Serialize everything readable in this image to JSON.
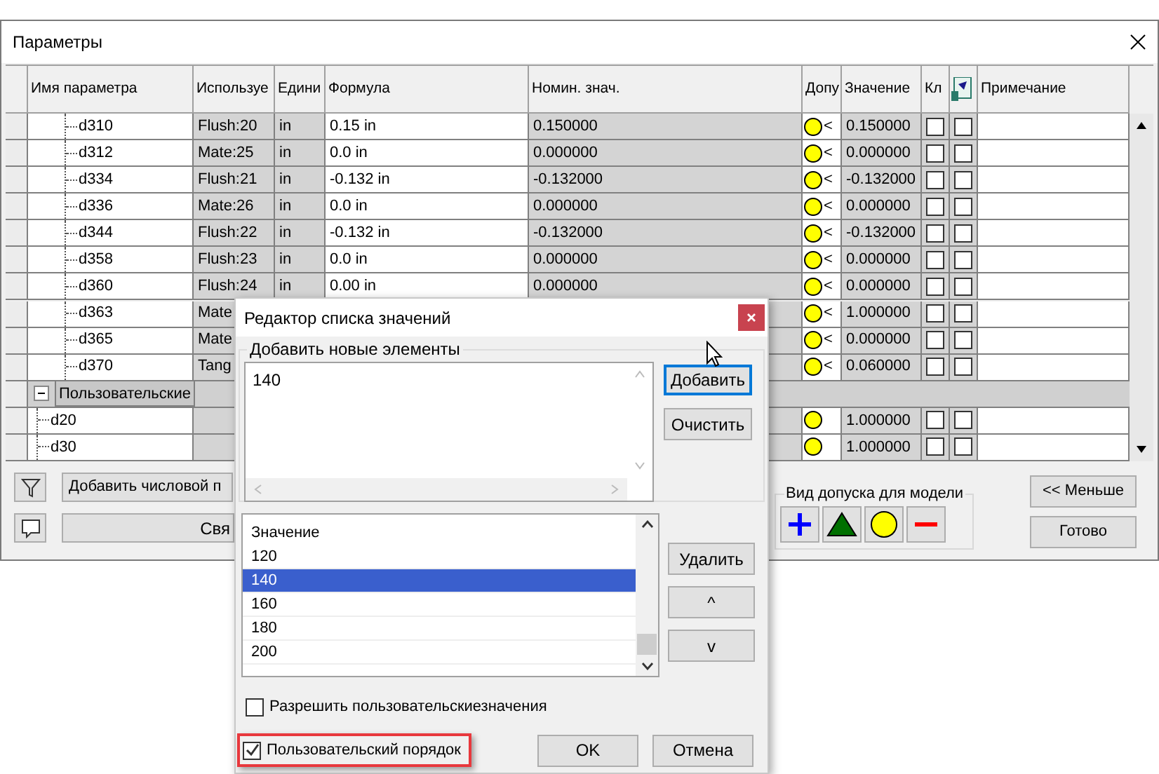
{
  "window": {
    "title": "Параметры"
  },
  "table": {
    "columns": [
      "Имя параметра",
      "Используе",
      "Едини",
      "Формула",
      "Номин. знач.",
      "Допу",
      "Значение",
      "Кл",
      "Примечание"
    ],
    "tree": [
      {
        "kind": "param",
        "name": "d310",
        "used": "Flush:20",
        "unit": "in",
        "formula": "0.15 in",
        "nominal": "0.150000",
        "mark": "<",
        "value": "0.150000",
        "key": false,
        "export": false
      },
      {
        "kind": "param",
        "name": "d312",
        "used": "Mate:25",
        "unit": "in",
        "formula": "0.0 in",
        "nominal": "0.000000",
        "mark": "<",
        "value": "0.000000",
        "key": false,
        "export": false
      },
      {
        "kind": "param",
        "name": "d334",
        "used": "Flush:21",
        "unit": "in",
        "formula": "-0.132 in",
        "nominal": "-0.132000",
        "mark": "<",
        "value": "-0.132000",
        "key": false,
        "export": false
      },
      {
        "kind": "param",
        "name": "d336",
        "used": "Mate:26",
        "unit": "in",
        "formula": "0.0 in",
        "nominal": "0.000000",
        "mark": "<",
        "value": "0.000000",
        "key": false,
        "export": false
      },
      {
        "kind": "param",
        "name": "d344",
        "used": "Flush:22",
        "unit": "in",
        "formula": "-0.132 in",
        "nominal": "-0.132000",
        "mark": "<",
        "value": "-0.132000",
        "key": false,
        "export": false
      },
      {
        "kind": "param",
        "name": "d358",
        "used": "Flush:23",
        "unit": "in",
        "formula": "0.0 in",
        "nominal": "0.000000",
        "mark": "<",
        "value": "0.000000",
        "key": false,
        "export": false
      },
      {
        "kind": "param",
        "name": "d360",
        "used": "Flush:24",
        "unit": "in",
        "formula": "0.00 in",
        "nominal": "0.000000",
        "mark": "<",
        "value": "0.000000",
        "key": false,
        "export": false
      },
      {
        "kind": "param",
        "name": "d363",
        "used": "Mate",
        "mark": "<",
        "value": "1.000000",
        "key": false,
        "export": false
      },
      {
        "kind": "param",
        "name": "d365",
        "used": "Mate",
        "mark": "<",
        "value": "0.000000",
        "key": false,
        "export": false
      },
      {
        "kind": "param",
        "name": "d370",
        "used": "Tang",
        "mark": "<",
        "value": "0.060000",
        "key": false,
        "export": false
      },
      {
        "kind": "group",
        "label": "Пользовательские",
        "expanded": true,
        "children": [
          {
            "kind": "param",
            "name": "d20",
            "value": "1.000000",
            "key": false,
            "export": false
          },
          {
            "kind": "param",
            "name": "d30",
            "value": "1.000000",
            "key": false,
            "export": false
          }
        ]
      }
    ]
  },
  "bottom": {
    "add_button": "Добавить числовой п",
    "link_button": "Свя",
    "tolerance_group": "Вид допуска для модели",
    "less_button": "<< Меньше",
    "done_button": "Готово"
  },
  "dialog": {
    "title": "Редактор списка значений",
    "add_group": "Добавить новые элементы",
    "new_items": "140",
    "add": "Добавить",
    "clear": "Очистить",
    "list_header": "Значение",
    "items": [
      {
        "label": "120",
        "selected": false
      },
      {
        "label": "140",
        "selected": true
      },
      {
        "label": "160",
        "selected": false
      },
      {
        "label": "180",
        "selected": false
      },
      {
        "label": "200",
        "selected": false
      }
    ],
    "delete": "Удалить",
    "up": "^",
    "down": "v",
    "options": [
      {
        "label": "Разрешить пользовательскиезначения",
        "checked": false,
        "highlighted": false
      },
      {
        "label": "Пользовательский порядок",
        "checked": true,
        "highlighted": true
      }
    ],
    "ok": "OK",
    "cancel": "Отмена"
  }
}
